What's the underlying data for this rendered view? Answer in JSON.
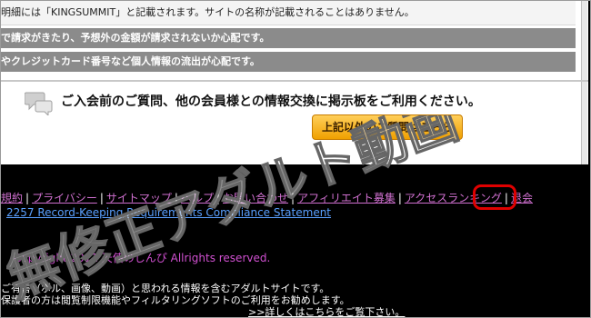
{
  "panel": {
    "row1_text": "明細には「KINGSUMMIT」と記載されます。サイトの名称が記載されることはありません。",
    "warning1": "で請求がきたり、予想外の金額が請求されないか心配です。",
    "warning2": "やクレジットカード番号など個人情報の流出が心配です。",
    "bbs_text": "ご入会前のご質問、他の会員様との情報交換に掲示板をご利用ください。",
    "bbs_button": "上記以外のご質問はこちら"
  },
  "nav": {
    "items": [
      {
        "label": "規約"
      },
      {
        "label": "プライバシー"
      },
      {
        "label": "サイトマップ"
      },
      {
        "label": "ヘルプ"
      },
      {
        "label": "お問い合わせ"
      },
      {
        "label": "アフィリエイト募集"
      },
      {
        "label": "アクセスランキング"
      },
      {
        "label": "退会"
      }
    ],
    "separator": "|"
  },
  "footer": {
    "record": "2257 Record-Keeping Requirements Compliance Statement",
    "copyright": "Copyright 2011 天使のしんぴ Allrights reserved.",
    "notice1": "ご有害（ポル、画像、動画）と思われる情報を含むアダルトサイトです。",
    "notice2": "保護者の方は閲覧制限機能やフィルタリングソフトのご利用をお勧めします。",
    "more": ">>詳しくはこちらをご覧下さい。"
  },
  "watermark": {
    "text": "無修正アダルト動画",
    "color": "#ffffff"
  },
  "colors": {
    "nav_link": "#d070d0",
    "highlight": "#e00000",
    "record_link": "#5aa0ff"
  }
}
